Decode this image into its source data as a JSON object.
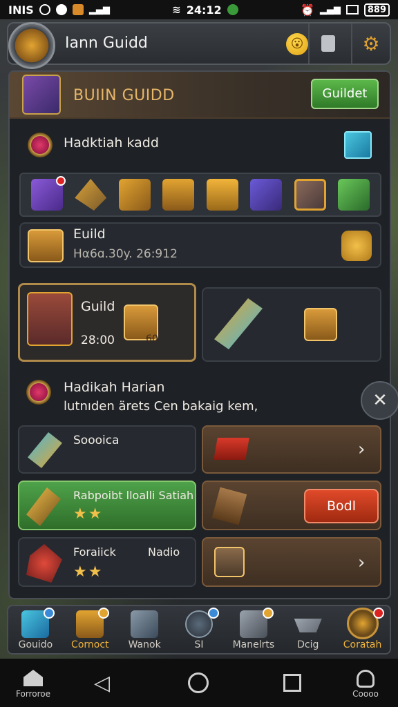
{
  "status_bar": {
    "left_text": "INIS",
    "time": "24:12",
    "battery": "889"
  },
  "header": {
    "title": "Iann Guidd",
    "emoji": "😮",
    "action_icon": "share-icon",
    "settings_icon": "gear-icon"
  },
  "panel": {
    "title": "BUIIN GUIDD",
    "title_button": "Guildet",
    "gift_row_label": "Hadktiah kadd",
    "items": [
      {
        "icon": "ticket-icon"
      },
      {
        "icon": "arrow-icon"
      },
      {
        "icon": "lock-chest-icon"
      },
      {
        "icon": "chest-icon"
      },
      {
        "icon": "gold-chest-icon"
      },
      {
        "icon": "purple-chest-icon"
      },
      {
        "icon": "robot-chest-icon"
      },
      {
        "icon": "potion-icon"
      }
    ],
    "guild_row": {
      "title": "Euild",
      "subtitle": "Hα6ɑ.30y. 26:912"
    },
    "feature_card": {
      "title": "Guild",
      "value": "28:00",
      "chest_label": "60"
    },
    "daily": {
      "title": "Hadikah Harian",
      "subtitle": "lutnıden ärets Cen bakaig kem,"
    },
    "quests": [
      {
        "title": "Soooica",
        "stars": ""
      },
      {
        "title": "Rabpoibt lloalli Satiah",
        "stars": "★★"
      },
      {
        "title": "Foraiick",
        "tag": "Nadio",
        "stars": "★★"
      }
    ],
    "claim_button": "Bodl"
  },
  "tabs": [
    {
      "label": "Gouido"
    },
    {
      "label": "Cornoct"
    },
    {
      "label": "Wanok"
    },
    {
      "label": "SI"
    },
    {
      "label": "Manelrts"
    },
    {
      "label": "Dcig"
    },
    {
      "label": "Coratah"
    }
  ],
  "navbar": {
    "left_label": "Forroroe",
    "right_label": "Coooo"
  },
  "colors": {
    "accent_gold": "#e6b66a",
    "green": "#4ea24a",
    "red": "#e04a2a"
  }
}
